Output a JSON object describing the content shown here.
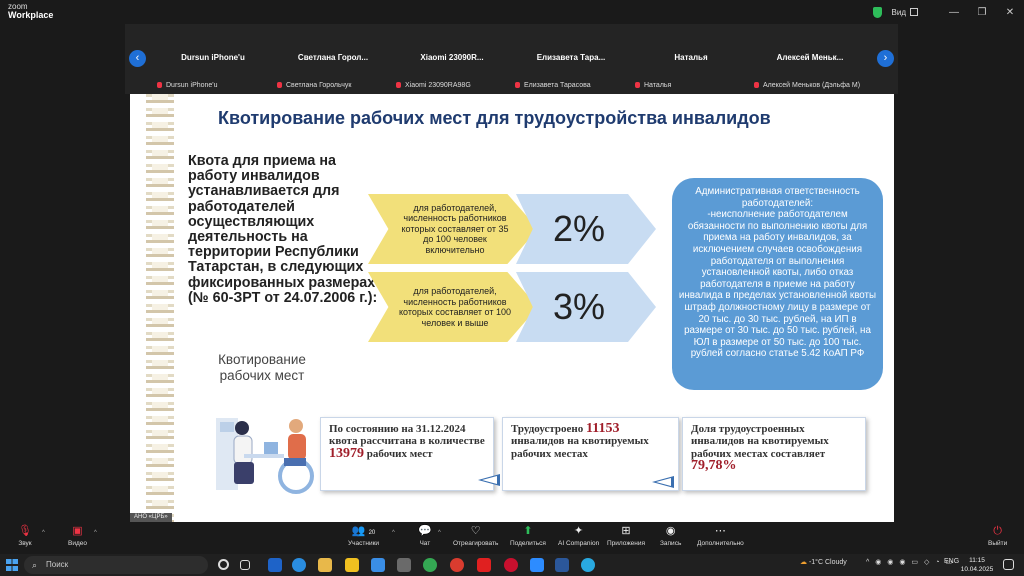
{
  "app": {
    "logo_top": "zoom",
    "logo_bottom": "Workplace",
    "view_label": "Вид",
    "minimize": "—",
    "maximize": "❐",
    "close": "✕"
  },
  "participants": [
    {
      "name": "Dursun iPhone'u",
      "label": "Dursun iPhone'u"
    },
    {
      "name": "Светлана  Горол...",
      "label": "Светлана Горольчук"
    },
    {
      "name": "Xiaomi 23090R...",
      "label": "Xiaomi 23090RA98G"
    },
    {
      "name": "Елизавета  Тара...",
      "label": "Елизавета Тарасова"
    },
    {
      "name": "Наталья",
      "label": "Наталья"
    },
    {
      "name": "Алексей  Меньк...",
      "label": "Алексей Меньков (Дэльфа М)"
    }
  ],
  "slide": {
    "title": "Квотирование рабочих мест для трудоустройства инвалидов",
    "quota_text": "Квота для приема на работу инвалидов устанавливается для работодателей осуществляющих деятельность на территории Республики Татарстан, в следующих фиксированных размерах (№ 60-ЗРТ от 24.07.2006 г.):",
    "tier1_text": "для работодателей, численность работников которых составляет от 35 до 100 человек включительно",
    "tier1_value": "2%",
    "tier2_text": "для работодателей, численность работников которых составляет от 100 человек и выше",
    "tier2_value": "3%",
    "admin_text": "Административная ответственность работодателей:\n-неисполнение работодателем обязанности по выполнению квоты для приема на работу инвалидов, за исключением случаев освобождения работодателя от выполнения установленной квоты, либо отказ работодателя в приеме на работу инвалида в пределах установленной квоты штраф должностному лицу в размере от 20 тыс. до 30 тыс. рублей, на ИП в размере от 30 тыс. до 50 тыс. рублей, на ЮЛ в размере от 50 тыс. до 100 тыс. рублей согласно статье 5.42 КоАП РФ",
    "kv_label": "Квотирование рабочих мест",
    "stat1_a": "По состоянию на 31.12.2024 квота рассчитана в количестве",
    "stat1_num": "13979",
    "stat1_b": "рабочих мест",
    "stat2_a": "Трудоустроено",
    "stat2_num": "11153",
    "stat2_b": "инвалидов на квотируемых рабочих местах",
    "stat3_a": "Доля трудоустроенных инвалидов на квотируемых рабочих местах составляет",
    "stat3_num": "79,78%",
    "speaker": "АНО «ЦРБ»"
  },
  "toolbar": {
    "audio": "Звук",
    "video": "Видео",
    "participants": "Участники",
    "participants_count": "20",
    "chat": "Чат",
    "react": "Отреагировать",
    "share": "Поделиться",
    "ai": "AI Companion",
    "apps": "Приложения",
    "record": "Запись",
    "more": "Дополнительно",
    "leave": "Выйти"
  },
  "taskbar": {
    "search": "Поиск",
    "weather": "-1°C  Cloudy",
    "lang": "ENG",
    "time": "11:15",
    "date": "10.04.2025"
  },
  "colors": {
    "title_blue": "#1f3b6f",
    "admin_blue": "#5b9bd5",
    "arrow_yellow": "#f2e07a",
    "arrow_blue": "#c8dcf2",
    "accent_red": "#a01e2a"
  }
}
